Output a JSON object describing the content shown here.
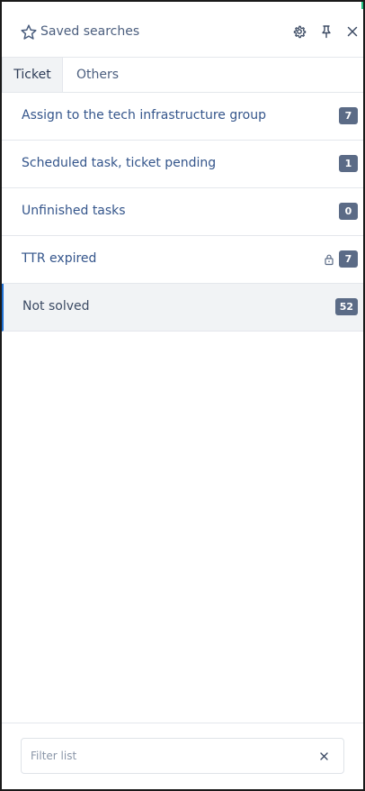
{
  "header": {
    "title": "Saved searches",
    "icons": [
      "star-icon",
      "gear-icon",
      "pin-icon",
      "close-icon"
    ]
  },
  "tabs": [
    {
      "label": "Ticket",
      "active": true
    },
    {
      "label": "Others",
      "active": false
    }
  ],
  "searches": [
    {
      "label": "Assign to the tech infrastructure group",
      "count": "7",
      "locked": false,
      "selected": false
    },
    {
      "label": "Scheduled task, ticket pending",
      "count": "1",
      "locked": false,
      "selected": false
    },
    {
      "label": "Unfinished tasks",
      "count": "0",
      "locked": false,
      "selected": false
    },
    {
      "label": "TTR expired",
      "count": "7",
      "locked": true,
      "selected": false
    },
    {
      "label": "Not solved",
      "count": "52",
      "locked": false,
      "selected": true
    }
  ],
  "filter": {
    "placeholder": "Filter list",
    "value": ""
  },
  "colors": {
    "badge": "#5b6b86",
    "selected_border": "#1f6fd0",
    "text": "#34558b"
  }
}
